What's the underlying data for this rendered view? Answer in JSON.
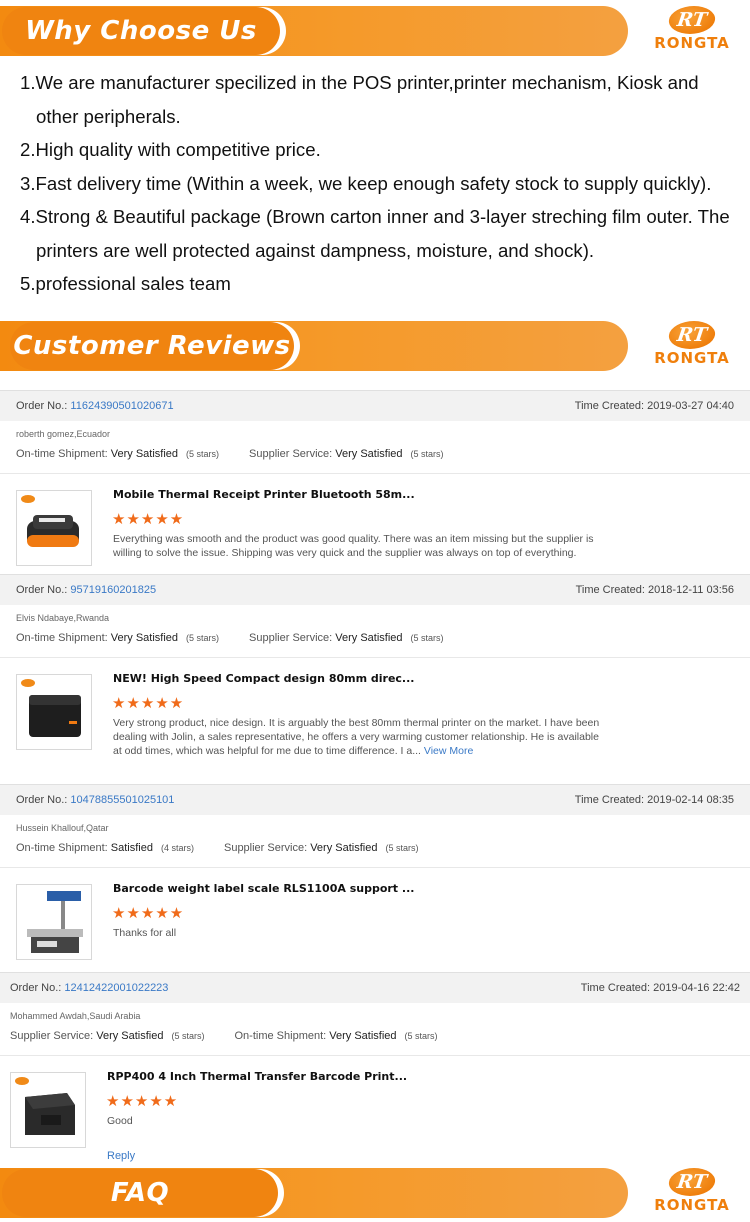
{
  "brand": {
    "logo_mark": "RT",
    "logo_name": "RONGTA"
  },
  "sections": {
    "why": "Why Choose Us",
    "reviews": "Customer Reviews",
    "faq": "FAQ"
  },
  "why_points": [
    "1.We are manufacturer specilized in the POS printer,printer mechanism, Kiosk and other peripherals.",
    "2.High quality with competitive price.",
    "3.Fast delivery time (Within a week, we keep enough safety stock to supply quickly).",
    "4.Strong & Beautiful package (Brown carton inner and 3-layer streching film outer. The printers are well protected against dampness, moisture, and shock).",
    "5.professional sales team"
  ],
  "labels": {
    "order_no": "Order No.:",
    "time_created": "Time Created:",
    "ontime": "On-time Shipment:",
    "supplier": "Supplier Service:",
    "view_more": "View More",
    "reply": "Reply"
  },
  "reviews": [
    {
      "order": "11624390501020671",
      "time": "2019-03-27 04:40",
      "reviewer": "roberth gomez,Ecuador",
      "ontime_value": "Very Satisfied",
      "ontime_stars": "(5 stars)",
      "supplier_value": "Very Satisfied",
      "supplier_stars": "(5 stars)",
      "product": "Mobile Thermal Receipt Printer Bluetooth 58m...",
      "stars": "★★★★★",
      "text": "Everything was smooth and the product was good quality. There was an item missing but the supplier is willing to solve the issue. Shipping was very quick and the supplier was always on top of everything."
    },
    {
      "order": "95719160201825",
      "time": "2018-12-11 03:56",
      "reviewer": "Elvis Ndabaye,Rwanda",
      "ontime_value": "Very Satisfied",
      "ontime_stars": "(5 stars)",
      "supplier_value": "Very Satisfied",
      "supplier_stars": "(5 stars)",
      "product": "NEW! High Speed Compact design 80mm direc...",
      "stars": "★★★★★",
      "text": "Very strong product, nice design. It is arguably the best 80mm thermal printer on the market. I have been dealing with Jolin, a sales representative, he offers a very warming customer relationship. He is available at odd times, which was helpful for me due to time difference. I a..."
    },
    {
      "order": "10478855501025101",
      "time": "2019-02-14 08:35",
      "reviewer": "Hussein Khallouf,Qatar",
      "ontime_value": "Satisfied",
      "ontime_stars": "(4 stars)",
      "supplier_value": "Very Satisfied",
      "supplier_stars": "(5 stars)",
      "product": "Barcode weight label scale RLS1100A support ...",
      "stars": "★★★★★",
      "text": "Thanks for all"
    },
    {
      "order": "12412422001022223",
      "time": "2019-04-16 22:42",
      "reviewer": "Mohammed Awdah,Saudi Arabia",
      "first_label": "Supplier Service:",
      "first_value": "Very Satisfied",
      "first_stars": "(5 stars)",
      "second_label": "On-time Shipment:",
      "second_value": "Very Satisfied",
      "second_stars": "(5 stars)",
      "product": "RPP400 4 Inch Thermal Transfer Barcode Print...",
      "stars": "★★★★★",
      "text": "Good"
    }
  ],
  "colors": {
    "brand_orange": "#f08410",
    "link_blue": "#3a79c6",
    "star_orange": "#f06b1a"
  }
}
